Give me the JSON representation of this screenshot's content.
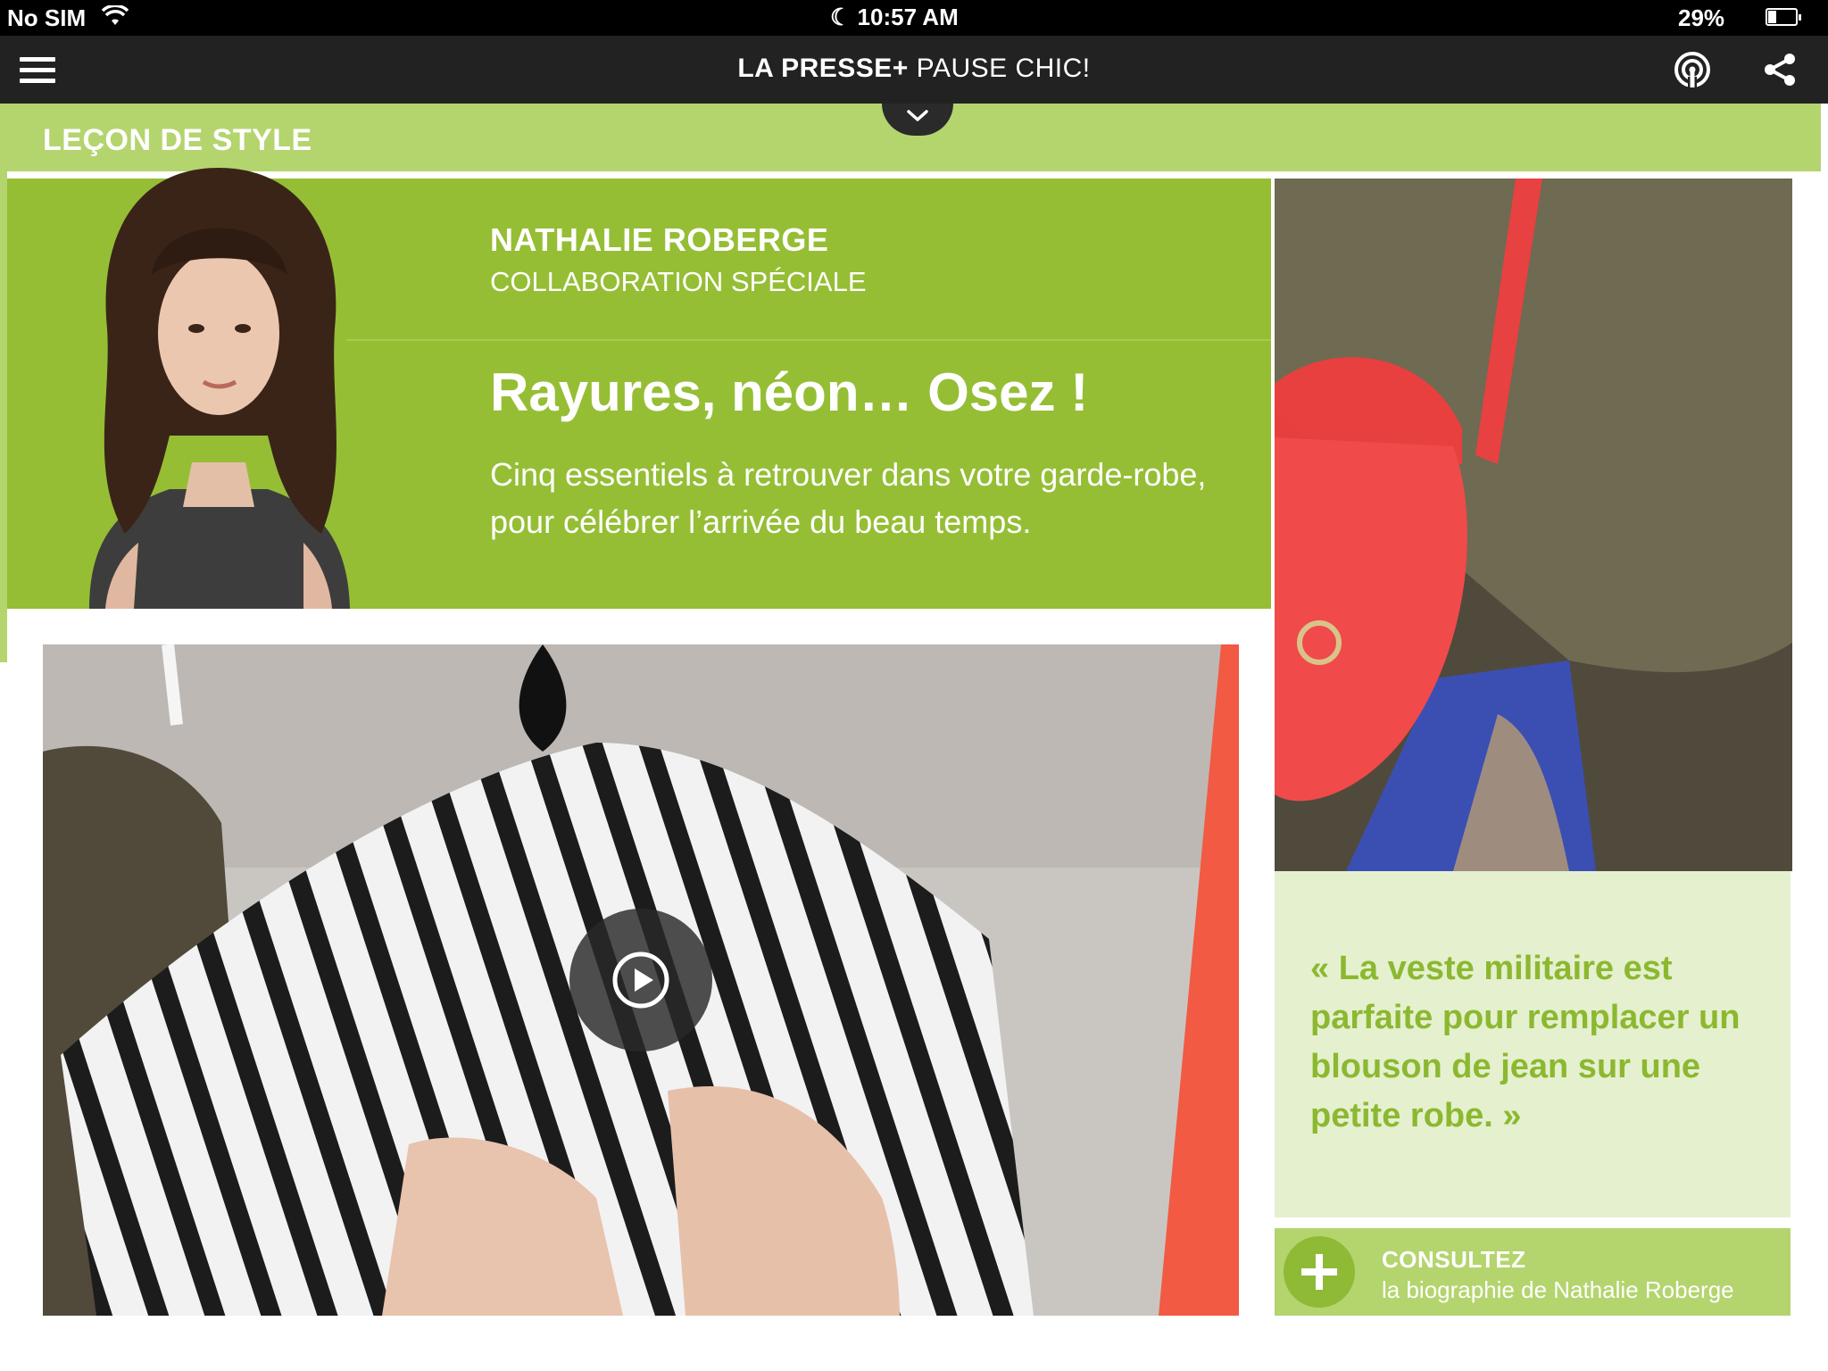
{
  "status_bar": {
    "carrier": "No SIM",
    "time": "10:57 AM",
    "battery": "29%"
  },
  "nav": {
    "brand": "LA PRESSE+",
    "section": "PAUSE CHIC!"
  },
  "section_header": {
    "label": "LEÇON DE STYLE"
  },
  "article": {
    "author_name": "NATHALIE ROBERGE",
    "author_role": "COLLABORATION SPÉCIALE",
    "headline": "Rayures, néon… Osez !",
    "dek": "Cinq essentiels à retrouver dans votre garde-robe, pour célébrer l’arrivée du beau temps."
  },
  "quote": {
    "text": "« La veste militaire est parfaite pour remplacer un blouson de jean sur une petite robe. »"
  },
  "bio_link": {
    "title": "CONSULTEZ",
    "subtitle": "la biographie de Nathalie Roberge"
  },
  "colors": {
    "accent_green": "#95be35",
    "light_green": "#b4d46e",
    "quote_bg": "#e5f0cf",
    "nav_bg": "#222222"
  },
  "icons": [
    "menu-icon",
    "broadcast-icon",
    "share-icon",
    "chevron-down-icon",
    "play-icon",
    "plus-icon",
    "wifi-icon",
    "moon-icon",
    "battery-icon"
  ]
}
